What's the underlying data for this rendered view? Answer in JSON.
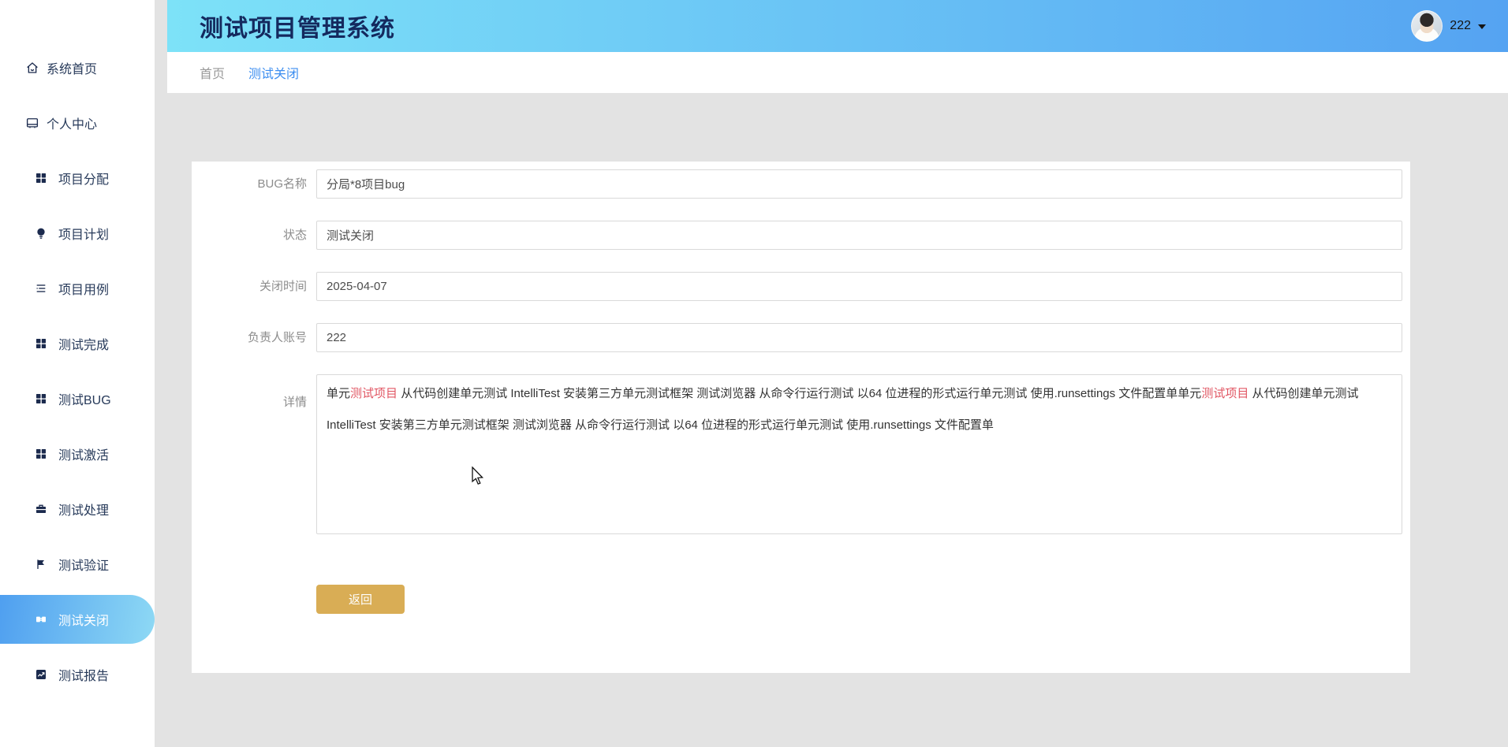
{
  "app": {
    "title": "测试项目管理系统"
  },
  "user": {
    "name": "222",
    "caret_icon": "chevron-down"
  },
  "tabs": [
    {
      "key": "home",
      "label": "首页",
      "active": false
    },
    {
      "key": "test-close",
      "label": "测试关闭",
      "active": true
    }
  ],
  "sidebar": {
    "items": [
      {
        "key": "system-home",
        "label": "系统首页",
        "icon": "home-icon",
        "sub": false,
        "active": false
      },
      {
        "key": "profile",
        "label": "个人中心",
        "icon": "profile-icon",
        "sub": false,
        "active": false
      },
      {
        "key": "project-assign",
        "label": "项目分配",
        "icon": "grid-icon",
        "sub": true,
        "active": false
      },
      {
        "key": "project-plan",
        "label": "项目计划",
        "icon": "bulb-icon",
        "sub": true,
        "active": false
      },
      {
        "key": "project-case",
        "label": "项目用例",
        "icon": "list-icon",
        "sub": true,
        "active": false
      },
      {
        "key": "test-complete",
        "label": "测试完成",
        "icon": "grid-icon",
        "sub": true,
        "active": false
      },
      {
        "key": "test-bug",
        "label": "测试BUG",
        "icon": "grid-icon",
        "sub": true,
        "active": false
      },
      {
        "key": "test-activate",
        "label": "测试激活",
        "icon": "grid-icon",
        "sub": true,
        "active": false
      },
      {
        "key": "test-process",
        "label": "测试处理",
        "icon": "toolbox-icon",
        "sub": true,
        "active": false
      },
      {
        "key": "test-verify",
        "label": "测试验证",
        "icon": "flag-icon",
        "sub": true,
        "active": false
      },
      {
        "key": "test-close",
        "label": "测试关闭",
        "icon": "ticket-icon",
        "sub": true,
        "active": true
      },
      {
        "key": "test-report",
        "label": "测试报告",
        "icon": "report-icon",
        "sub": true,
        "active": false
      }
    ]
  },
  "form": {
    "fields": [
      {
        "key": "bug-name",
        "label": "BUG名称",
        "value": "分局*8项目bug"
      },
      {
        "key": "status",
        "label": "状态",
        "value": "测试关闭"
      },
      {
        "key": "close-time",
        "label": "关闭时间",
        "value": "2025-04-07"
      },
      {
        "key": "owner-account",
        "label": "负责人账号",
        "value": "222"
      }
    ],
    "detail": {
      "label": "详情",
      "segments": [
        {
          "text": "单元",
          "red": false
        },
        {
          "text": "测试项目",
          "red": true
        },
        {
          "text": " 从代码创建单元测试 IntelliTest 安装第三方单元测试框架 测试浏览器 从命令行运行测试 以64 位进程的形式运行单元测试 使用.runsettings 文件配置单单元",
          "red": false
        },
        {
          "text": "测试项目",
          "red": true
        },
        {
          "text": " 从代码创建单元测试 IntelliTest 安装第三方单元测试框架 测试浏览器 从命令行运行测试 以64 位进程的形式运行单元测试 使用.runsettings 文件配置单",
          "red": false
        }
      ]
    },
    "back_button": "返回"
  },
  "colors": {
    "header_gradient_start": "#7de2f8",
    "header_gradient_end": "#55a3f2",
    "active_item_gradient_start": "#4f9ff0",
    "active_item_gradient_end": "#8ed9f4",
    "tab_active": "#3d8ef0",
    "link_red": "#e15663",
    "button_gold": "#d9ad55",
    "title_navy": "#14295e"
  }
}
